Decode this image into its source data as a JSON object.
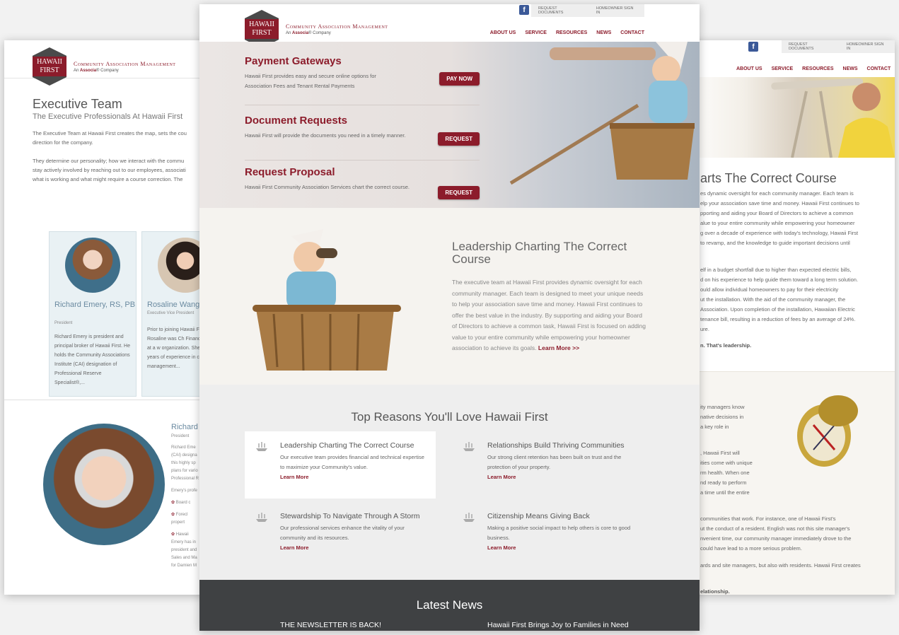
{
  "logo": {
    "line1": "HAWAII",
    "line2": "FIRST",
    "name": "Community Association Management",
    "sub_prefix": "An",
    "sub_brand": "Associa",
    "sub_suffix": "Company"
  },
  "topbar": {
    "request_docs": "REQUEST DOCUMENTS",
    "homeowner": "HOMEOWNER SIGN IN",
    "facebook": "f"
  },
  "nav": [
    "ABOUT US",
    "SERVICE",
    "RESOURCES",
    "NEWS",
    "CONTACT"
  ],
  "left_page": {
    "title": "Executive Team",
    "subtitle": "The Executive Professionals At Hawaii First",
    "para1": [
      "The Executive Team at Hawaii First creates the map, sets the cou",
      "direction for the company."
    ],
    "para2": [
      "They determine our personality; how we interact with the commu",
      "stay actively involved by reaching out to our employees, associati",
      "what is working and what might require a course correction. The"
    ],
    "cards": [
      {
        "name": "Richard Emery, RS, PB",
        "role": "President",
        "text": "Richard Emery is president and principal broker of Hawaii First. He holds the Community Associations Institute (CAI) designation of Professional Reserve Specialist®,..."
      },
      {
        "name": "Rosaline Wang",
        "role": "Executive Vice President",
        "text": "Prior to joining Hawaii F 1997, Rosaline was Ch Financial Officer at a w organization. She has d years of experience in c management..."
      }
    ],
    "bottom": {
      "name": "Richard",
      "role": "President",
      "lines": [
        "Richard Eme",
        "(CAI) designa",
        "this highly sp",
        "plans for vario",
        "Professional R",
        "",
        "Emery's profe",
        "",
        "Board c",
        "",
        "Forecl",
        "propert",
        "",
        "Hawaii",
        "Emery has in",
        "president and",
        "Sales and Ma",
        "for Damien M"
      ]
    }
  },
  "right_page": {
    "title": "arts The Correct Course",
    "lines1": [
      "es dynamic oversight for each community manager. Each team is",
      "elp your association save time and money. Hawaii First continues to",
      "pporting and aiding your Board of Directors to achieve a common",
      "alue to your entire community while empowering your homeowner",
      "g over a decade of experience with today's technology, Hawaii First",
      "to revamp, and the knowledge to guide important decisions until"
    ],
    "lines2": [
      "elf in a budget shortfall due to higher than expected electric bills,",
      "d on his experience to help guide them toward a long term solution.",
      "ould allow individual homeowners to pay for their electricity",
      "ut the installation. With the aid of the community manager, the",
      "Association. Upon completion of the installation, Hawaiian Electric",
      "tenance bill, resulting in a reduction of fees by an average of 24%.",
      "ure."
    ],
    "leadership": "n. That's leadership.",
    "bottom_lines1": [
      "ity managers know",
      "native decisions in",
      "a key role in"
    ],
    "bottom_lines2": [
      ", Hawaii First will",
      "ities come with unique",
      "rm health. When one",
      "nd ready to perform",
      "a time until the entire"
    ],
    "bottom_lines3": [
      "communities that work. For instance, one of Hawaii First's",
      "ut the conduct of a resident. English was not this site manager's",
      "nvenient time, our community manager immediately drove to the",
      "could have lead to a more serious problem."
    ],
    "bottom_lines4": [
      "ards and site managers, but also with residents. Hawaii First creates"
    ],
    "relationship": "elationship."
  },
  "hero": {
    "items": [
      {
        "title": "Payment Gateways",
        "desc": "Hawaii First provides easy and secure online options for Association Fees and Tenant Rental Payments",
        "button": "PAY NOW"
      },
      {
        "title": "Document Requests",
        "desc": "Hawaii First will provide the documents you need in a timely manner.",
        "button": "REQUEST"
      },
      {
        "title": "Request Proposal",
        "desc": "Hawaii First Community Association Services chart the correct course.",
        "button": "REQUEST"
      }
    ]
  },
  "leadership": {
    "title": "Leadership Charting The Correct Course",
    "text": "The executive team at Hawaii First provides dynamic oversight for each community manager. Each team is designed to meet your unique needs to help your association save time and money. Hawaii First continues to offer the best value in the industry. By supporting and aiding your Board of Directors to achieve a common task, Hawaii First is focused on adding value to your entire community while empowering your homeowner association to achieve its goals.",
    "more": "Learn More >>"
  },
  "reasons": {
    "title": "Top Reasons You'll Love Hawaii First",
    "items": [
      {
        "title": "Leadership Charting The Correct Course",
        "desc": "Our executive team provides financial and technical expertise to maximize your Community's value.",
        "more": "Learn More"
      },
      {
        "title": "Relationships Build Thriving Communities",
        "desc": "Our strong client retention has been built on trust and the protection of your property.",
        "more": "Learn More"
      },
      {
        "title": "Stewardship To Navigate Through A Storm",
        "desc": "Our professional services enhance the vitality of your community and its resources.",
        "more": "Learn More"
      },
      {
        "title": "Citizenship Means Giving Back",
        "desc": "Making a positive social impact to help others is core to good business.",
        "more": "Learn More"
      }
    ]
  },
  "news": {
    "title": "Latest News",
    "items": [
      "THE NEWSLETTER IS BACK!",
      "Hawaii First Brings Joy to Families in Need"
    ]
  },
  "colors": {
    "brand": "#8c1c2b",
    "accent_blue": "#6a8aa0",
    "dark": "#3f4143"
  }
}
